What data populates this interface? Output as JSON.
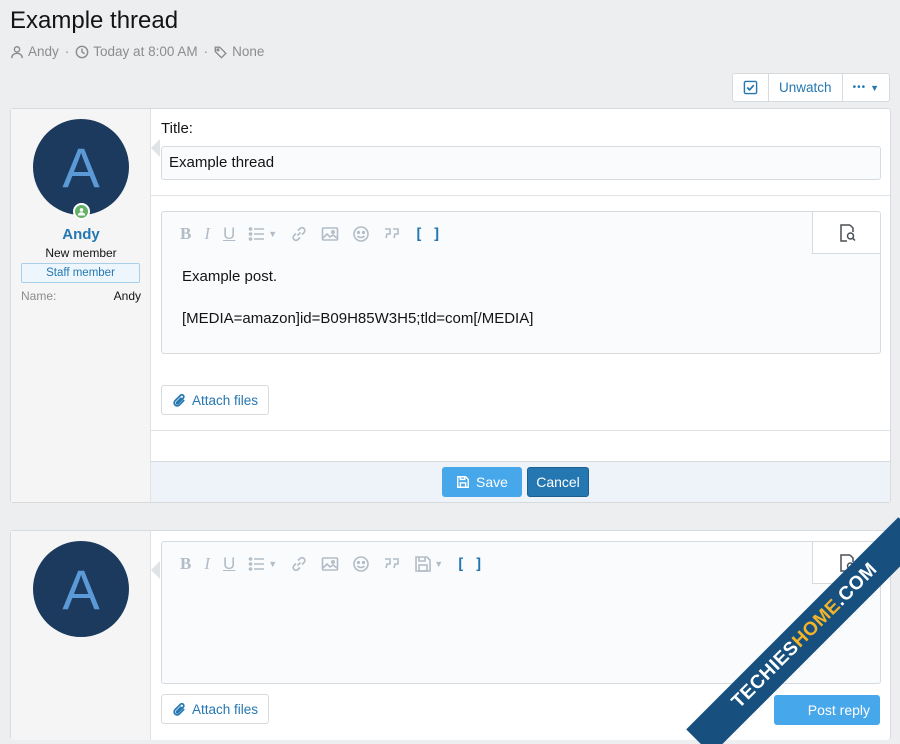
{
  "thread": {
    "title": "Example thread",
    "author": "Andy",
    "date": "Today at 8:00 AM",
    "tags": "None"
  },
  "thread_actions": {
    "unwatch_label": "Unwatch",
    "more_label": "•••"
  },
  "post": {
    "avatar_letter": "A",
    "username": "Andy",
    "user_title": "New member",
    "banner": "Staff member",
    "extra_key": "Name:",
    "extra_value": "Andy",
    "title_label": "Title:",
    "title_value": "Example thread",
    "body_line1": "Example post.",
    "body_line2": "[MEDIA=amazon]id=B09H85W3H5;tld=com[/MEDIA]",
    "attach_label": "Attach files",
    "save_label": "Save",
    "cancel_label": "Cancel"
  },
  "editor_toolbar": {
    "bold": "B",
    "italic": "I",
    "underline": "U",
    "code": "[ ]"
  },
  "quick_reply": {
    "avatar_letter": "A",
    "attach_label": "Attach files",
    "post_reply_label": "Post reply"
  },
  "watermark": {
    "text_a": "TECHIES",
    "text_b": "HOME",
    "text_c": ".COM"
  },
  "colors": {
    "link": "#2577b1",
    "avatar_bg": "#1b3a5e",
    "avatar_fg": "#5b9ad6",
    "online": "#63b265",
    "save_button": "#47a7eb",
    "cancel_button": "#2577b1"
  }
}
